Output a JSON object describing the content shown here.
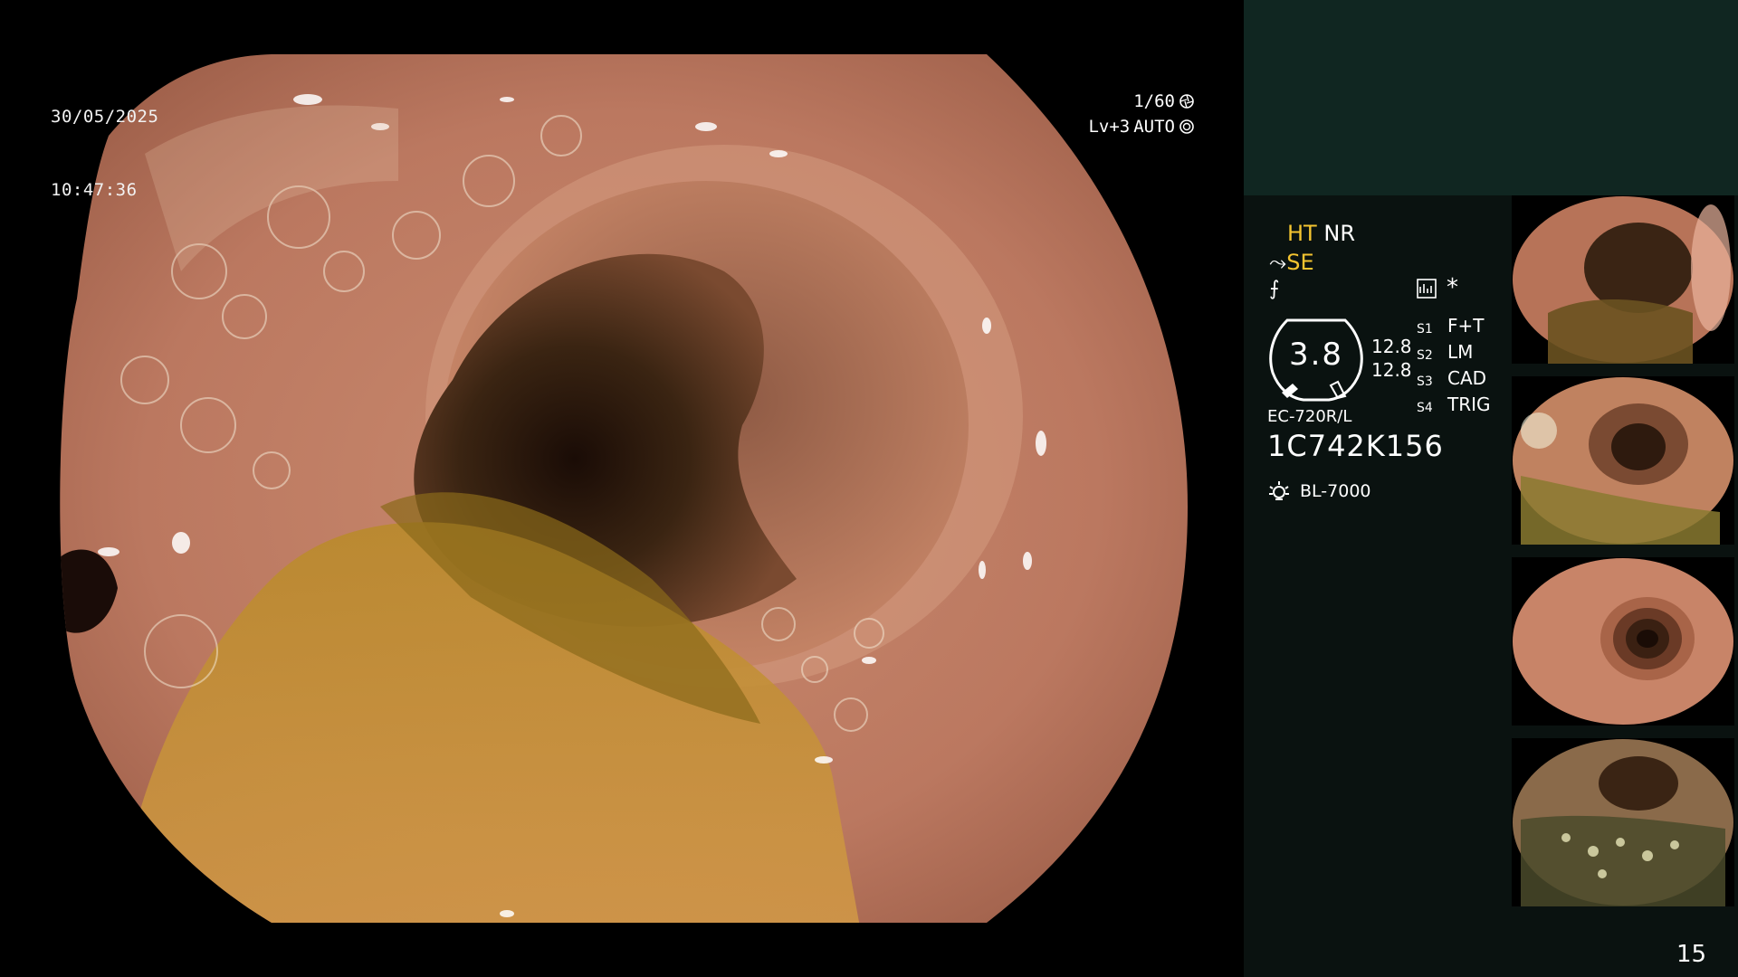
{
  "overlay": {
    "date": "30/05/2025",
    "time": "10:47:36",
    "shutter": "1/60",
    "level": "Lv+3",
    "iris": "AUTO"
  },
  "enhancement": {
    "ht_label": "HT",
    "nr_label": "NR",
    "se_label": "SE"
  },
  "gauge": {
    "value": "3.8",
    "upper_reading": "12.8",
    "lower_reading": "12.8"
  },
  "switches": [
    {
      "key": "S1",
      "value": "F+T"
    },
    {
      "key": "S2",
      "value": "LM"
    },
    {
      "key": "S3",
      "value": "CAD"
    },
    {
      "key": "S4",
      "value": "TRIG"
    }
  ],
  "scope": {
    "model": "EC-720R/L",
    "serial": "1C742K156",
    "light_source": "BL-7000"
  },
  "thumbnails": [
    {
      "id": "thumb-1"
    },
    {
      "id": "thumb-2"
    },
    {
      "id": "thumb-3"
    },
    {
      "id": "thumb-4"
    }
  ],
  "page_number": "15",
  "colors": {
    "mode_active": "#f4c430",
    "panel_bg": "#0b1311",
    "panel_top": "#102621"
  }
}
